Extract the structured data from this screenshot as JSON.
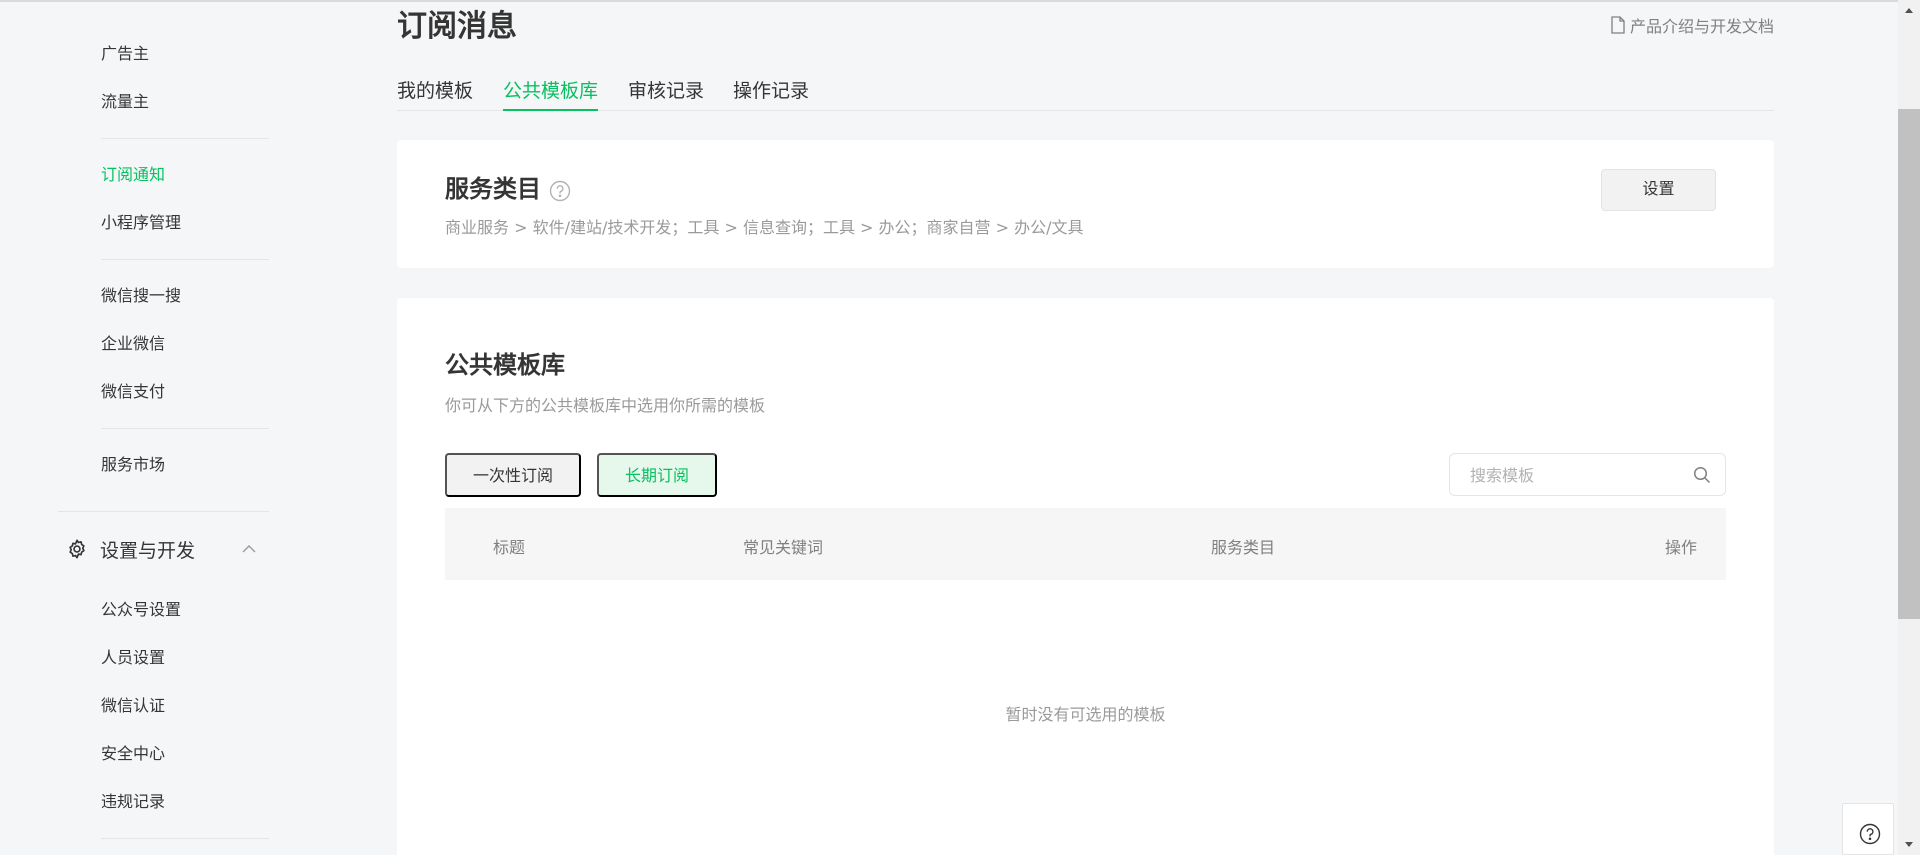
{
  "sidebar": {
    "items": [
      {
        "label": "广告主"
      },
      {
        "label": "流量主"
      },
      {
        "label": "订阅通知"
      },
      {
        "label": "小程序管理"
      },
      {
        "label": "微信搜一搜"
      },
      {
        "label": "企业微信"
      },
      {
        "label": "微信支付"
      },
      {
        "label": "服务市场"
      }
    ],
    "group": {
      "title": "设置与开发",
      "icon": "gear-icon",
      "chevron": "chevron-up-icon"
    },
    "sub_items": [
      {
        "label": "公众号设置"
      },
      {
        "label": "人员设置"
      },
      {
        "label": "微信认证"
      },
      {
        "label": "安全中心"
      },
      {
        "label": "违规记录"
      }
    ]
  },
  "header": {
    "title": "订阅消息",
    "doc_link": "产品介绍与开发文档",
    "doc_icon": "document-icon"
  },
  "tabs": [
    {
      "label": "我的模板"
    },
    {
      "label": "公共模板库"
    },
    {
      "label": "审核记录"
    },
    {
      "label": "操作记录"
    }
  ],
  "active_tab": "公共模板库",
  "service_category": {
    "title": "服务类目",
    "help_icon": "question-icon",
    "path": "商业服务  >  软件/建站/技术开发；工具  >  信息查询；工具  >  办公；商家自营  >  办公/文具",
    "button": "设置"
  },
  "library": {
    "title": "公共模板库",
    "description": "你可从下方的公共模板库中选用你所需的模板",
    "segments": [
      {
        "label": "一次性订阅"
      },
      {
        "label": "长期订阅"
      }
    ],
    "active_segment": "长期订阅",
    "search": {
      "placeholder": "搜索模板",
      "value": ""
    },
    "columns": [
      "标题",
      "常见关键词",
      "服务类目",
      "操作"
    ],
    "empty_text": "暂时没有可选用的模板"
  },
  "colors": {
    "accent": "#07c160",
    "background": "#f5f6f7"
  }
}
